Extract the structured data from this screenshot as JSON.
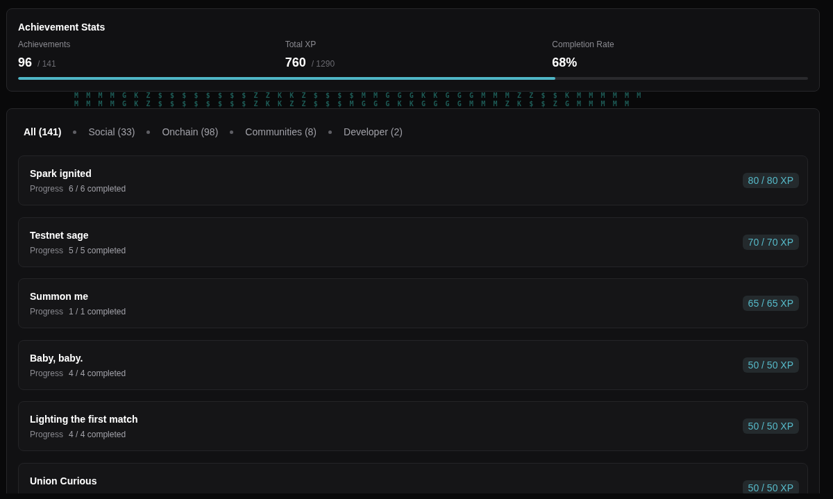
{
  "stats": {
    "title": "Achievement Stats",
    "items": [
      {
        "label": "Achievements",
        "value": "96",
        "total": "/ 141"
      },
      {
        "label": "Total XP",
        "value": "760",
        "total": "/ 1290"
      },
      {
        "label": "Completion Rate",
        "value": "68%"
      }
    ],
    "progress": {
      "level": 0.68
    }
  },
  "background_glyph_rows": [
    "M M M M G K Z $ $ $ $ $ $ $ $ Z Z K K Z $ $ $ $ M M G G G K K G G G M M M Z Z $ $ K M M M M M M",
    "M M M M G K Z $ $ $ $ $ $ $ $ Z K K Z Z $ $ $ M G G G K K G G G G M M M Z K $ $ Z G M M M M M"
  ],
  "tabs": [
    {
      "label": "All (141)",
      "selected": true
    },
    {
      "label": "Social (33)",
      "selected": false
    },
    {
      "label": "Onchain (98)",
      "selected": false
    },
    {
      "label": "Communities (8)",
      "selected": false
    },
    {
      "label": "Developer (2)",
      "selected": false
    }
  ],
  "achievements": [
    {
      "title": "Spark ignited",
      "progress_label": "Progress",
      "progress": "6 / 6 completed",
      "xp": "80 / 80 XP"
    },
    {
      "title": "Testnet sage",
      "progress_label": "Progress",
      "progress": "5 / 5 completed",
      "xp": "70 / 70 XP"
    },
    {
      "title": "Summon me",
      "progress_label": "Progress",
      "progress": "1 / 1 completed",
      "xp": "65 / 65 XP"
    },
    {
      "title": "Baby, baby.",
      "progress_label": "Progress",
      "progress": "4 / 4 completed",
      "xp": "50 / 50 XP"
    },
    {
      "title": "Lighting the first match",
      "progress_label": "Progress",
      "progress": "4 / 4 completed",
      "xp": "50 / 50 XP"
    },
    {
      "title": "Union Curious",
      "xp": "50 / 50 XP"
    }
  ]
}
